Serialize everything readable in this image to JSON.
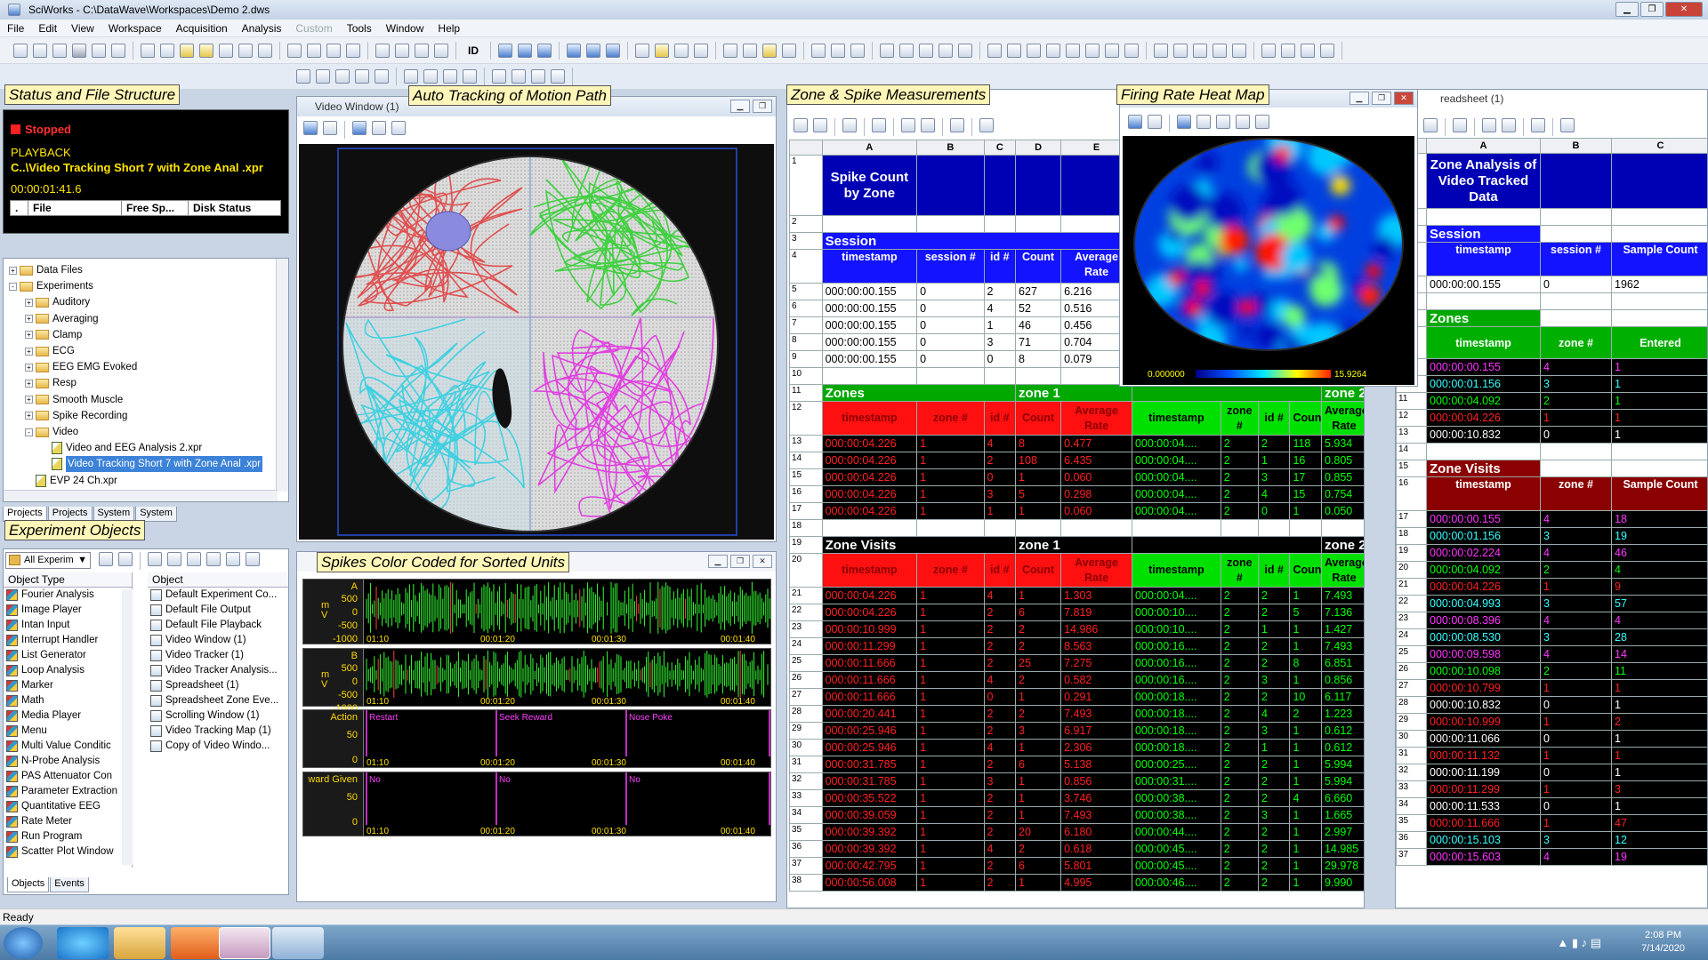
{
  "app": {
    "title": "SciWorks - C:\\DataWave\\Workspaces\\Demo 2.dws",
    "ready": "Ready"
  },
  "menu": [
    "File",
    "Edit",
    "View",
    "Workspace",
    "Acquisition",
    "Analysis",
    "Custom",
    "Tools",
    "Window",
    "Help"
  ],
  "toolbar": {
    "id_label": "ID"
  },
  "labels": {
    "status": "Status and File Structure",
    "auto": "Auto Tracking of Motion Path",
    "zone": "Zone & Spike Measurements",
    "heat": "Firing Rate Heat Map",
    "expobj": "Experiment Objects",
    "spikes": "Spikes Color Coded for Sorted Units"
  },
  "status": {
    "state": "Stopped",
    "mode": "PLAYBACK",
    "file": "C..\\Video Tracking Short 7 with Zone Anal .xpr",
    "time": "00:00:01:41.6",
    "cols": [
      ".",
      "File",
      "Free Sp...",
      "Disk Status"
    ]
  },
  "tree": [
    {
      "t": "Data Files",
      "lvl": 0,
      "pm": "+",
      "k": "f"
    },
    {
      "t": "Experiments",
      "lvl": 0,
      "pm": "-",
      "k": "f"
    },
    {
      "t": "Auditory",
      "lvl": 1,
      "pm": "+",
      "k": "f"
    },
    {
      "t": "Averaging",
      "lvl": 1,
      "pm": "+",
      "k": "f"
    },
    {
      "t": "Clamp",
      "lvl": 1,
      "pm": "+",
      "k": "f"
    },
    {
      "t": "ECG",
      "lvl": 1,
      "pm": "+",
      "k": "f"
    },
    {
      "t": "EEG EMG Evoked",
      "lvl": 1,
      "pm": "+",
      "k": "f"
    },
    {
      "t": "Resp",
      "lvl": 1,
      "pm": "+",
      "k": "f"
    },
    {
      "t": "Smooth Muscle",
      "lvl": 1,
      "pm": "+",
      "k": "f"
    },
    {
      "t": "Spike Recording",
      "lvl": 1,
      "pm": "+",
      "k": "f"
    },
    {
      "t": "Video",
      "lvl": 1,
      "pm": "-",
      "k": "f"
    },
    {
      "t": "Video and EEG Analysis 2.xpr",
      "lvl": 2,
      "pm": "",
      "k": "d"
    },
    {
      "t": "Video Tracking Short 7 with Zone Anal .xpr",
      "lvl": 2,
      "pm": "",
      "k": "d",
      "sel": true
    },
    {
      "t": "EVP 24 Ch.xpr",
      "lvl": 1,
      "pm": "",
      "k": "d"
    }
  ],
  "tree_tabs": [
    "Projects",
    "Projects",
    "System",
    "System"
  ],
  "objects": {
    "filter": "All Experim",
    "col1": "Object Type",
    "col2": "Object",
    "types": [
      "Fourier Analysis",
      "Image Player",
      "Intan Input",
      "Interrupt Handler",
      "List Generator",
      "Loop Analysis",
      "Marker",
      "Math",
      "Media Player",
      "Menu",
      "Multi Value Conditic",
      "N-Probe Analysis",
      "PAS Attenuator Con",
      "Parameter Extraction",
      "Quantitative EEG",
      "Rate Meter",
      "Run Program",
      "Scatter Plot Window"
    ],
    "items": [
      "Default Experiment Co...",
      "Default File Output",
      "Default File Playback",
      "Video Window (1)",
      "Video Tracker (1)",
      "Video Tracker Analysis...",
      "Spreadsheet (1)",
      "Spreadsheet Zone Eve...",
      "Scrolling Window (1)",
      "Video Tracking Map (1)",
      "Copy of Video Windo..."
    ],
    "tabs": [
      "Objects",
      "Events"
    ]
  },
  "video": {
    "title": "Video Window (1)"
  },
  "spikes": {
    "traces": [
      {
        "ch": "A",
        "ticks": [
          "500",
          "0",
          "-500",
          "-1000"
        ],
        "unit": "m\nV",
        "times": [
          "01:10",
          "00:01:20",
          "00:01:30",
          "00:01:40"
        ]
      },
      {
        "ch": "B",
        "ticks": [
          "500",
          "0",
          "-500",
          "-1000"
        ],
        "unit": "m\nV",
        "times": [
          "01:10",
          "00:01:20",
          "00:01:30",
          "00:01:40"
        ]
      },
      {
        "ch": "Action",
        "ticks": [
          "50",
          "0"
        ],
        "unit": "",
        "times": [
          "01:10",
          "00:01:20",
          "00:01:30",
          "00:01:40"
        ],
        "events": [
          "Restart",
          "Seek Reward",
          "Nose Poke",
          "Nose"
        ]
      },
      {
        "ch": "ward Given",
        "ticks": [
          "50",
          "0"
        ],
        "unit": "",
        "times": [
          "01:10",
          "00:01:20",
          "00:01:30",
          "00:01:40"
        ],
        "events": [
          "No",
          "No",
          "No",
          "No"
        ]
      }
    ]
  },
  "sheet1": {
    "cols": [
      "A",
      "B",
      "C",
      "D",
      "E",
      "",
      ""
    ],
    "title": "Spike Count by Zone",
    "session": "Session",
    "sess_hdr": [
      "timestamp",
      "session #",
      "id #",
      "Count",
      "Average Rate"
    ],
    "sess_rows": [
      [
        "000:00:00.155",
        "0",
        "2",
        "627",
        "6.216"
      ],
      [
        "000:00:00.155",
        "0",
        "4",
        "52",
        "0.516"
      ],
      [
        "000:00:00.155",
        "0",
        "1",
        "46",
        "0.456"
      ],
      [
        "000:00:00.155",
        "0",
        "3",
        "71",
        "0.704"
      ],
      [
        "000:00:00.155",
        "0",
        "0",
        "8",
        "0.079"
      ]
    ],
    "zones": "Zones",
    "zone1": "zone 1",
    "zone2": "zone 2",
    "zone_hdr": [
      "timestamp",
      "zone #",
      "id #",
      "Count",
      "Average Rate",
      "timestamp",
      "zone #",
      "id #",
      "Count",
      "Average Rate"
    ],
    "zone_rows": [
      [
        "000:00:04.226",
        "1",
        "4",
        "8",
        "0.477",
        "000:00:04....",
        "2",
        "2",
        "118",
        "5.934"
      ],
      [
        "000:00:04.226",
        "1",
        "2",
        "108",
        "6.435",
        "000:00:04....",
        "2",
        "1",
        "16",
        "0.805"
      ],
      [
        "000:00:04.226",
        "1",
        "0",
        "1",
        "0.060",
        "000:00:04....",
        "2",
        "3",
        "17",
        "0.855"
      ],
      [
        "000:00:04.226",
        "1",
        "3",
        "5",
        "0.298",
        "000:00:04....",
        "2",
        "4",
        "15",
        "0.754"
      ],
      [
        "000:00:04.226",
        "1",
        "1",
        "1",
        "0.060",
        "000:00:04....",
        "2",
        "0",
        "1",
        "0.050"
      ]
    ],
    "visits": "Zone Visits",
    "visit_rows": [
      [
        "000:00:04.226",
        "1",
        "4",
        "1",
        "1.303",
        "000:00:04....",
        "2",
        "2",
        "1",
        "7.493"
      ],
      [
        "000:00:04.226",
        "1",
        "2",
        "6",
        "7.819",
        "000:00:10....",
        "2",
        "2",
        "5",
        "7.136"
      ],
      [
        "000:00:10.999",
        "1",
        "2",
        "2",
        "14.986",
        "000:00:10....",
        "2",
        "1",
        "1",
        "1.427"
      ],
      [
        "000:00:11.299",
        "1",
        "2",
        "2",
        "8.563",
        "000:00:16....",
        "2",
        "2",
        "1",
        "7.493"
      ],
      [
        "000:00:11.666",
        "1",
        "2",
        "25",
        "7.275",
        "000:00:16....",
        "2",
        "2",
        "8",
        "6.851"
      ],
      [
        "000:00:11.666",
        "1",
        "4",
        "2",
        "0.582",
        "000:00:16....",
        "2",
        "3",
        "1",
        "0.856"
      ],
      [
        "000:00:11.666",
        "1",
        "0",
        "1",
        "0.291",
        "000:00:18....",
        "2",
        "2",
        "10",
        "6.117"
      ],
      [
        "000:00:20.441",
        "1",
        "2",
        "2",
        "7.493",
        "000:00:18....",
        "2",
        "4",
        "2",
        "1.223"
      ],
      [
        "000:00:25.946",
        "1",
        "2",
        "3",
        "6.917",
        "000:00:18....",
        "2",
        "3",
        "1",
        "0.612"
      ],
      [
        "000:00:25.946",
        "1",
        "4",
        "1",
        "2.306",
        "000:00:18....",
        "2",
        "1",
        "1",
        "0.612"
      ],
      [
        "000:00:31.785",
        "1",
        "2",
        "6",
        "5.138",
        "000:00:25....",
        "2",
        "2",
        "1",
        "5.994"
      ],
      [
        "000:00:31.785",
        "1",
        "3",
        "1",
        "0.856",
        "000:00:31....",
        "2",
        "2",
        "1",
        "5.994"
      ],
      [
        "000:00:35.522",
        "1",
        "2",
        "1",
        "3.746",
        "000:00:38....",
        "2",
        "2",
        "4",
        "6.660"
      ],
      [
        "000:00:39.059",
        "1",
        "2",
        "1",
        "7.493",
        "000:00:38....",
        "2",
        "3",
        "1",
        "1.665"
      ],
      [
        "000:00:39.392",
        "1",
        "2",
        "20",
        "6.180",
        "000:00:44....",
        "2",
        "2",
        "1",
        "2.997"
      ],
      [
        "000:00:39.392",
        "1",
        "4",
        "2",
        "0.618",
        "000:00:45....",
        "2",
        "2",
        "1",
        "14.985"
      ],
      [
        "000:00:42.795",
        "1",
        "2",
        "6",
        "5.801",
        "000:00:45....",
        "2",
        "2",
        "1",
        "29.978"
      ],
      [
        "000:00:56.008",
        "1",
        "2",
        "1",
        "4.995",
        "000:00:46....",
        "2",
        "2",
        "1",
        "9.990"
      ]
    ]
  },
  "heat": {
    "min": "0.000000",
    "max": "15.9264"
  },
  "sheet2": {
    "title": "readsheet (1)",
    "cols": [
      "A",
      "B",
      "C"
    ],
    "head": "Zone Analysis of Video Tracked Data",
    "session": "Session",
    "sess_hdr": [
      "timestamp",
      "session #",
      "Sample Count"
    ],
    "sess_row": [
      "000:00:00.155",
      "0",
      "1962"
    ],
    "zones": "Zones",
    "zone_hdr": [
      "timestamp",
      "zone #",
      "Entered"
    ],
    "zone_rows": [
      [
        "000:00:00.155",
        "4",
        "1",
        "m"
      ],
      [
        "000:00:01.156",
        "3",
        "1",
        "c"
      ],
      [
        "000:00:04.092",
        "2",
        "1",
        "g"
      ],
      [
        "000:00:04.226",
        "1",
        "1",
        "r"
      ],
      [
        "000:00:10.832",
        "0",
        "1",
        "w"
      ]
    ],
    "visits": "Zone Visits",
    "visit_hdr": [
      "timestamp",
      "zone #",
      "Sample Count"
    ],
    "visit_rows": [
      [
        "000:00:00.155",
        "4",
        "18",
        "m"
      ],
      [
        "000:00:01.156",
        "3",
        "19",
        "c"
      ],
      [
        "000:00:02.224",
        "4",
        "46",
        "m"
      ],
      [
        "000:00:04.092",
        "2",
        "4",
        "g"
      ],
      [
        "000:00:04.226",
        "1",
        "9",
        "r"
      ],
      [
        "000:00:04.993",
        "3",
        "57",
        "c"
      ],
      [
        "000:00:08.396",
        "4",
        "4",
        "m"
      ],
      [
        "000:00:08.530",
        "3",
        "28",
        "c"
      ],
      [
        "000:00:09.598",
        "4",
        "14",
        "m"
      ],
      [
        "000:00:10.098",
        "2",
        "11",
        "g"
      ],
      [
        "000:00:10.799",
        "1",
        "1",
        "r"
      ],
      [
        "000:00:10.832",
        "0",
        "1",
        "w"
      ],
      [
        "000:00:10.999",
        "1",
        "2",
        "r"
      ],
      [
        "000:00:11.066",
        "0",
        "1",
        "w"
      ],
      [
        "000:00:11.132",
        "1",
        "1",
        "r"
      ],
      [
        "000:00:11.199",
        "0",
        "1",
        "w"
      ],
      [
        "000:00:11.299",
        "1",
        "3",
        "r"
      ],
      [
        "000:00:11.533",
        "0",
        "1",
        "w"
      ],
      [
        "000:00:11.666",
        "1",
        "47",
        "r"
      ],
      [
        "000:00:15.103",
        "3",
        "12",
        "c"
      ],
      [
        "000:00:15.603",
        "4",
        "19",
        "m"
      ]
    ]
  },
  "clock": {
    "time": "2:08 PM",
    "date": "7/14/2020"
  }
}
